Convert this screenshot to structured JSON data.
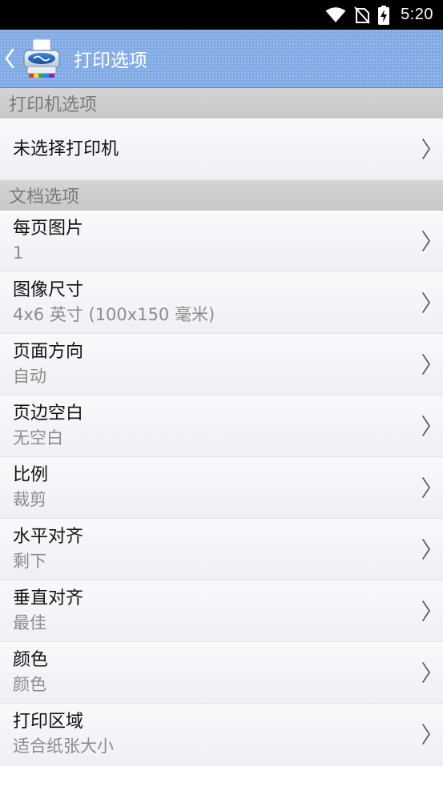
{
  "status_bar": {
    "time": "5:20",
    "icons": [
      "wifi-icon",
      "no-sim-icon",
      "battery-charging-icon"
    ]
  },
  "app_bar": {
    "title": "打印选项",
    "back_icon": "back-chevron-icon",
    "logo_icon": "printer-icon"
  },
  "printer_section": {
    "header": "打印机选项",
    "item": {
      "label": "未选择打印机"
    }
  },
  "document_section": {
    "header": "文档选项",
    "items": [
      {
        "label": "每页图片",
        "value": "1"
      },
      {
        "label": "图像尺寸",
        "value": "4x6 英寸 (100x150 毫米)"
      },
      {
        "label": "页面方向",
        "value": "自动"
      },
      {
        "label": "页边空白",
        "value": "无空白"
      },
      {
        "label": "比例",
        "value": "裁剪"
      },
      {
        "label": "水平对齐",
        "value": "剩下"
      },
      {
        "label": "垂直对齐",
        "value": "最佳"
      },
      {
        "label": "颜色",
        "value": "颜色"
      },
      {
        "label": "打印区域",
        "value": "适合纸张大小"
      }
    ]
  },
  "colors": {
    "app_bar": "#7fa9e5",
    "section_header": "#cfcfcf",
    "row_background": "#f3f4f7"
  }
}
